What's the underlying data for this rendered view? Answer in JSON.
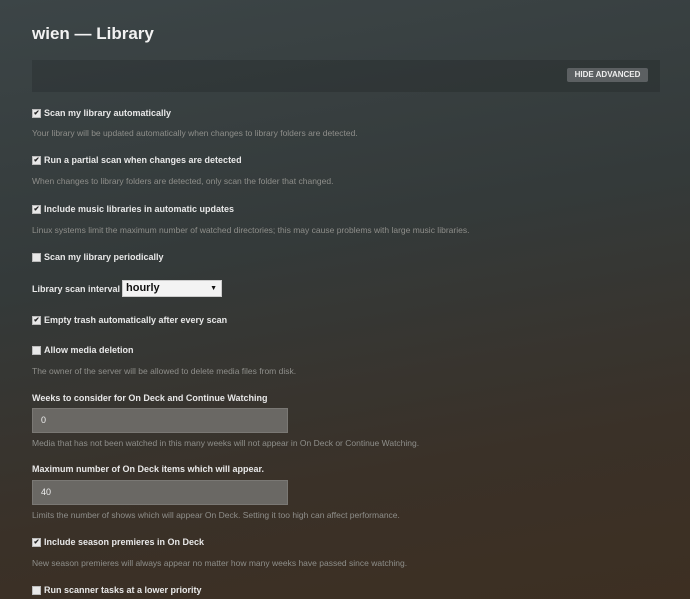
{
  "title": "wien — Library",
  "hide_advanced": "HIDE ADVANCED",
  "settings": [
    {
      "label": "Scan my library automatically",
      "checked": true,
      "desc": "Your library will be updated automatically when changes to library folders are detected."
    },
    {
      "label": "Run a partial scan when changes are detected",
      "checked": true,
      "desc": "When changes to library folders are detected, only scan the folder that changed."
    },
    {
      "label": "Include music libraries in automatic updates",
      "checked": true,
      "desc": "Linux systems limit the maximum number of watched directories; this may cause problems with large music libraries."
    },
    {
      "label": "Scan my library periodically",
      "checked": false
    },
    {
      "label": "Empty trash automatically after every scan",
      "checked": true
    },
    {
      "label": "Allow media deletion",
      "checked": false,
      "desc": "The owner of the server will be allowed to delete media files from disk."
    },
    {
      "label": "Include season premieres in On Deck",
      "checked": true,
      "desc": "New season premieres will always appear no matter how many weeks have passed since watching."
    },
    {
      "label": "Run scanner tasks at a lower priority",
      "checked": false
    }
  ],
  "interval": {
    "label": "Library scan interval",
    "value": "hourly"
  },
  "weeks": {
    "label": "Weeks to consider for On Deck and Continue Watching",
    "value": "0",
    "desc": "Media that has not been watched in this many weeks will not appear in On Deck or Continue Watching."
  },
  "max_items": {
    "label": "Maximum number of On Deck items which will appear.",
    "value": "40",
    "desc": "Limits the number of shows which will appear On Deck. Setting it too high can affect performance."
  }
}
